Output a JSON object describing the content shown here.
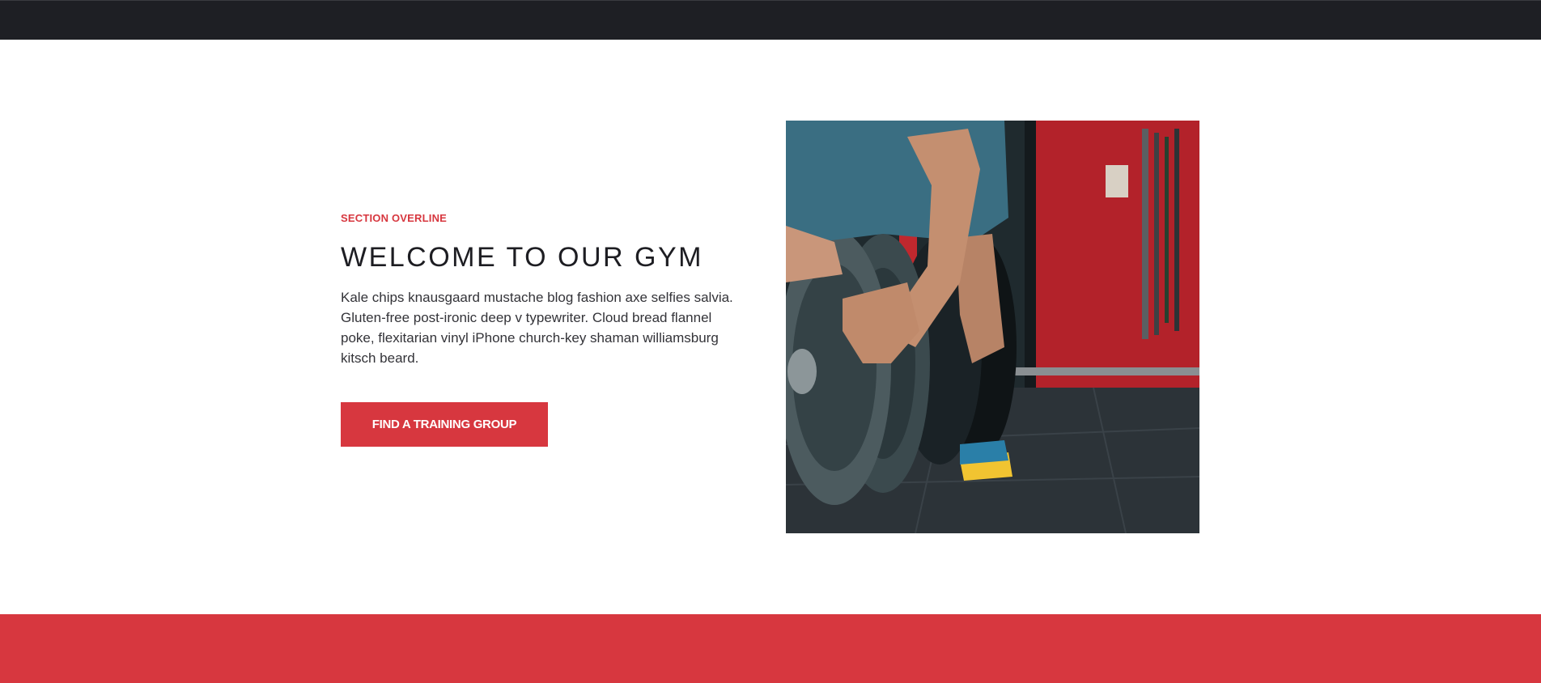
{
  "section": {
    "overline": "SECTION OVERLINE",
    "title": "WELCOME TO OUR GYM",
    "body": "Kale chips knausgaard mustache blog fashion axe selfies salvia. Gluten-free post-ironic deep v typewriter. Cloud bread flannel poke, flexitarian vinyl iPhone church-key shaman williamsburg kitsch beard.",
    "cta_label": "FIND A TRAINING GROUP"
  },
  "colors": {
    "accent": "#d7373f",
    "nav_background": "#1e1f24",
    "heading": "#1d1d22"
  }
}
